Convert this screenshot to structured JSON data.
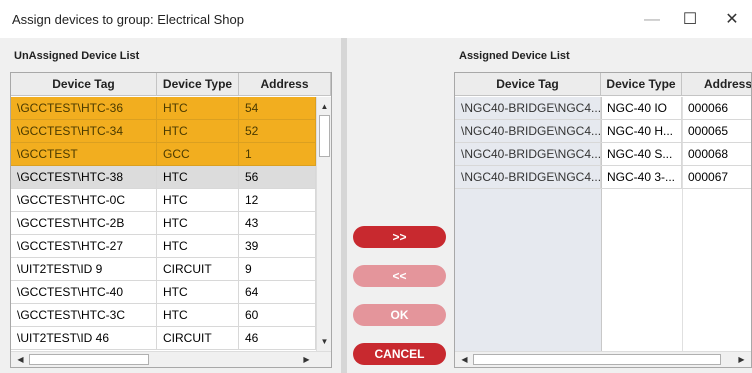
{
  "window": {
    "title": "Assign devices to group: Electrical Shop",
    "minimize_icon": "minimize-icon",
    "maximize_icon": "maximize-icon",
    "close_icon": "close-icon"
  },
  "unassigned": {
    "label": "UnAssigned Device List",
    "columns": [
      "Device Tag",
      "Device Type",
      "Address"
    ],
    "rows": [
      {
        "tag": "\\GCCTEST\\HTC-36",
        "type": "HTC",
        "address": "54",
        "state": "selected"
      },
      {
        "tag": "\\GCCTEST\\HTC-34",
        "type": "HTC",
        "address": "52",
        "state": "selected"
      },
      {
        "tag": "\\GCCTEST",
        "type": "GCC",
        "address": "1",
        "state": "selected"
      },
      {
        "tag": "\\GCCTEST\\HTC-38",
        "type": "HTC",
        "address": "56",
        "state": "focused"
      },
      {
        "tag": "\\GCCTEST\\HTC-0C",
        "type": "HTC",
        "address": "12",
        "state": "normal"
      },
      {
        "tag": "\\GCCTEST\\HTC-2B",
        "type": "HTC",
        "address": "43",
        "state": "normal"
      },
      {
        "tag": "\\GCCTEST\\HTC-27",
        "type": "HTC",
        "address": "39",
        "state": "normal"
      },
      {
        "tag": "\\UIT2TEST\\ID 9",
        "type": "CIRCUIT",
        "address": "9",
        "state": "normal"
      },
      {
        "tag": "\\GCCTEST\\HTC-40",
        "type": "HTC",
        "address": "64",
        "state": "normal"
      },
      {
        "tag": "\\GCCTEST\\HTC-3C",
        "type": "HTC",
        "address": "60",
        "state": "normal"
      },
      {
        "tag": "\\UIT2TEST\\ID 46",
        "type": "CIRCUIT",
        "address": "46",
        "state": "normal"
      }
    ]
  },
  "assigned": {
    "label": "Assigned Device List",
    "columns": [
      "Device Tag",
      "Device Type",
      "Address"
    ],
    "rows": [
      {
        "tag": "\\NGC40-BRIDGE\\NGC4...",
        "type": "NGC-40 IO",
        "address": "000066"
      },
      {
        "tag": "\\NGC40-BRIDGE\\NGC4...",
        "type": "NGC-40 H...",
        "address": "000065"
      },
      {
        "tag": "\\NGC40-BRIDGE\\NGC4...",
        "type": "NGC-40 S...",
        "address": "000068"
      },
      {
        "tag": "\\NGC40-BRIDGE\\NGC4...",
        "type": "NGC-40 3-...",
        "address": "000067"
      }
    ]
  },
  "actions": {
    "add_label": ">>",
    "remove_label": "<<",
    "ok_label": "OK",
    "cancel_label": "CANCEL"
  },
  "colors": {
    "selected_row": "#f2ae1f",
    "button_active": "#c8292f",
    "button_disabled": "#e4959b"
  }
}
